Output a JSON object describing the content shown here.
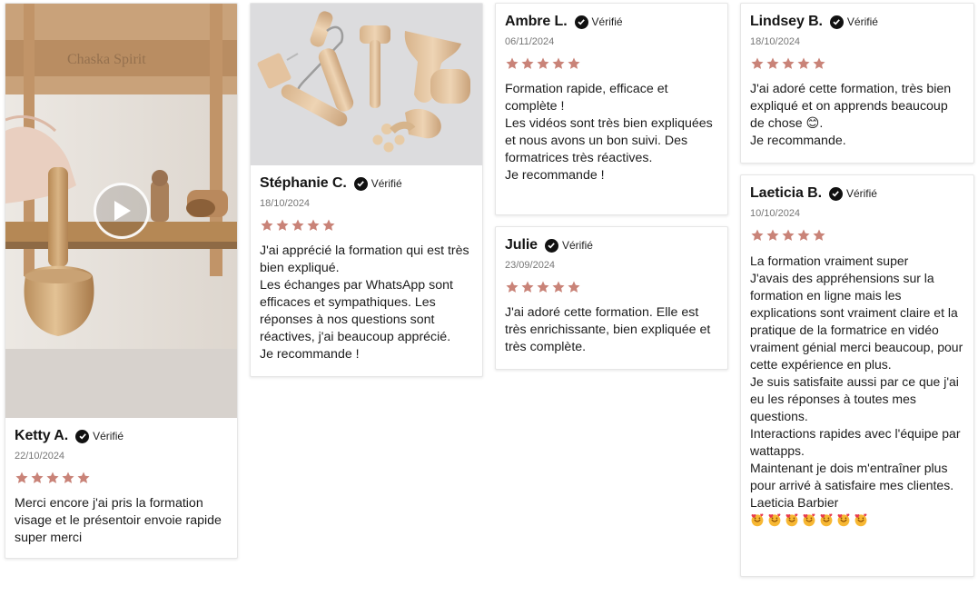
{
  "verified_label": "Vérifié",
  "star_color": "#c98378",
  "reviews": [
    {
      "name": "Ketty A.",
      "date": "22/10/2024",
      "rating": 5,
      "text": "Merci encore j'ai pris la formation visage et le présentoir envoie rapide super merci",
      "media": {
        "kind": "video",
        "watermark": "Chaska Spirit"
      }
    },
    {
      "name": "Stéphanie C.",
      "date": "18/10/2024",
      "rating": 5,
      "text": "J'ai apprécié la formation qui est très bien expliqué.\nLes échanges par WhatsApp sont efficaces et sympathiques. Les réponses à nos questions sont réactives, j'ai beaucoup apprécié.\nJe recommande !",
      "media": {
        "kind": "photo"
      }
    },
    {
      "name": "Ambre L.",
      "date": "06/11/2024",
      "rating": 5,
      "text": "Formation rapide, efficace et complète !\nLes vidéos sont très bien expliquées et nous avons un bon suivi. Des formatrices très réactives.\nJe recommande !"
    },
    {
      "name": "Julie",
      "date": "23/09/2024",
      "rating": 5,
      "text": "J'ai adoré cette formation. Elle est très enrichissante, bien expliquée et très complète."
    },
    {
      "name": "Lindsey B.",
      "date": "18/10/2024",
      "rating": 5,
      "text": "J'ai adoré cette formation, très bien expliqué et on apprends beaucoup de chose 😊.\nJe recommande."
    },
    {
      "name": "Laeticia B.",
      "date": "10/10/2024",
      "rating": 5,
      "text": "La formation vraiment super\nJ'avais des appréhensions sur la formation en ligne mais les explications sont vraiment claire et la pratique de la formatrice en vidéo vraiment génial merci beaucoup, pour cette expérience en plus.\nJe suis satisfaite aussi par ce que j'ai eu les réponses à toutes mes questions.\nInteractions rapides avec l'équipe par wattapps.\nMaintenant je dois m'entraîner plus pour arrivé à satisfaire mes clientes.\nLaeticia Barbier",
      "emoji_count": 7
    }
  ]
}
